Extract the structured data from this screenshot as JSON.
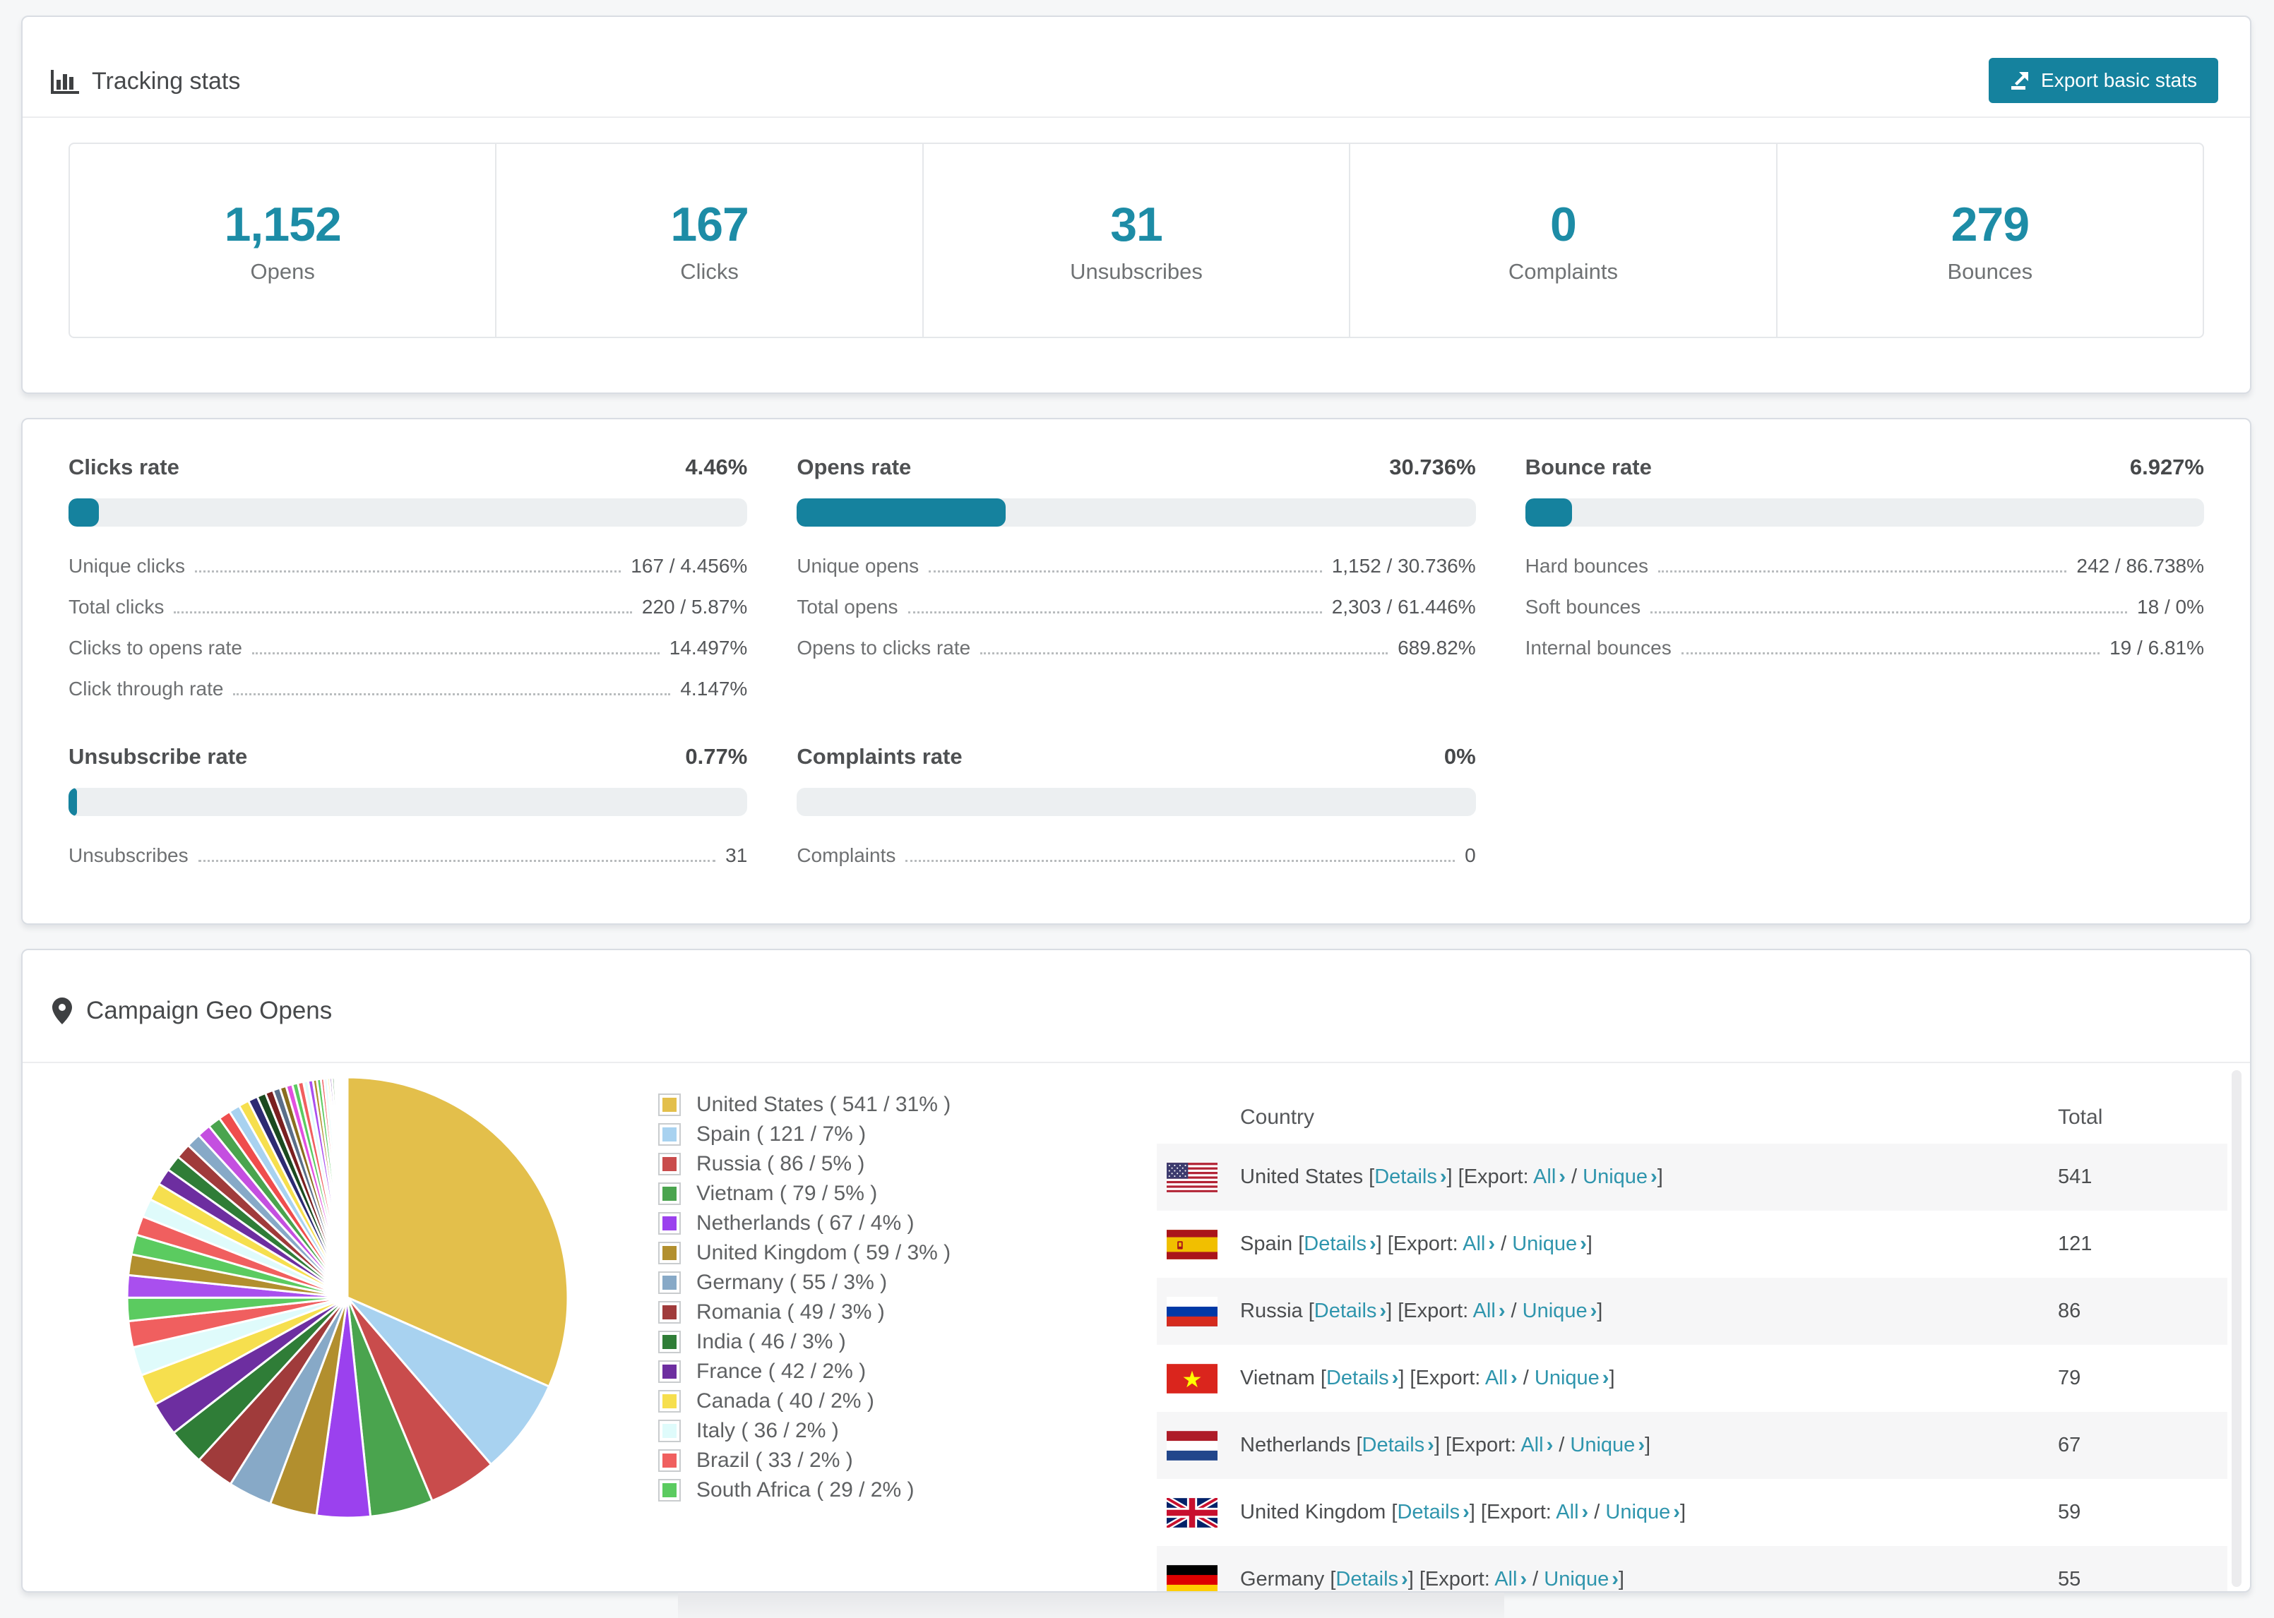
{
  "colors": {
    "accent": "#15829e",
    "number": "#1d8ca6",
    "link": "#2f95ad"
  },
  "header": {
    "icon": "bar-chart-icon",
    "title": "Tracking stats",
    "export_button": "Export basic stats"
  },
  "summary": [
    {
      "value": "1,152",
      "label": "Opens"
    },
    {
      "value": "167",
      "label": "Clicks"
    },
    {
      "value": "31",
      "label": "Unsubscribes"
    },
    {
      "value": "0",
      "label": "Complaints"
    },
    {
      "value": "279",
      "label": "Bounces"
    }
  ],
  "rates": [
    {
      "title": "Clicks rate",
      "percent": "4.46%",
      "fill": 4.46,
      "rows": [
        [
          "Unique clicks",
          "167 / 4.456%"
        ],
        [
          "Total clicks",
          "220 / 5.87%"
        ],
        [
          "Clicks to opens rate",
          "14.497%"
        ],
        [
          "Click through rate",
          "4.147%"
        ]
      ]
    },
    {
      "title": "Opens rate",
      "percent": "30.736%",
      "fill": 30.736,
      "rows": [
        [
          "Unique opens",
          "1,152 / 30.736%"
        ],
        [
          "Total opens",
          "2,303 / 61.446%"
        ],
        [
          "Opens to clicks rate",
          "689.82%"
        ]
      ]
    },
    {
      "title": "Bounce rate",
      "percent": "6.927%",
      "fill": 6.927,
      "rows": [
        [
          "Hard bounces",
          "242 / 86.738%"
        ],
        [
          "Soft bounces",
          "18 / 0%"
        ],
        [
          "Internal bounces",
          "19 / 6.81%"
        ]
      ]
    },
    {
      "title": "Unsubscribe rate",
      "percent": "0.77%",
      "fill": 0.77,
      "rows": [
        [
          "Unsubscribes",
          "31"
        ]
      ]
    },
    {
      "title": "Complaints rate",
      "percent": "0%",
      "fill": 0,
      "rows": [
        [
          "Complaints",
          "0"
        ]
      ]
    }
  ],
  "geo": {
    "icon": "map-marker-icon",
    "title": "Campaign Geo Opens",
    "chart_data": {
      "type": "pie",
      "title": "Campaign Geo Opens",
      "legend_position": "right",
      "start_angle_deg": 0,
      "slices": [
        {
          "label": "United States",
          "value": 541,
          "pct": "31%",
          "color": "#e3bf4b"
        },
        {
          "label": "Spain",
          "value": 121,
          "pct": "7%",
          "color": "#a8d2f0"
        },
        {
          "label": "Russia",
          "value": 86,
          "pct": "5%",
          "color": "#c94c4c"
        },
        {
          "label": "Vietnam",
          "value": 79,
          "pct": "5%",
          "color": "#4aa44e"
        },
        {
          "label": "Netherlands",
          "value": 67,
          "pct": "4%",
          "color": "#9b41ee"
        },
        {
          "label": "United Kingdom",
          "value": 59,
          "pct": "3%",
          "color": "#b28f2e"
        },
        {
          "label": "Germany",
          "value": 55,
          "pct": "3%",
          "color": "#87a9c7"
        },
        {
          "label": "Romania",
          "value": 49,
          "pct": "3%",
          "color": "#a03b3b"
        },
        {
          "label": "India",
          "value": 46,
          "pct": "3%",
          "color": "#2f7d37"
        },
        {
          "label": "France",
          "value": 42,
          "pct": "2%",
          "color": "#6d2ea0"
        },
        {
          "label": "Canada",
          "value": 40,
          "pct": "2%",
          "color": "#f6df4e"
        },
        {
          "label": "Italy",
          "value": 36,
          "pct": "2%",
          "color": "#dffbfb"
        },
        {
          "label": "Brazil",
          "value": 33,
          "pct": "2%",
          "color": "#f05f5f"
        },
        {
          "label": "South Africa",
          "value": 29,
          "pct": "2%",
          "color": "#5bcb60"
        }
      ],
      "others_tail": {
        "values": [
          28,
          26,
          25,
          24,
          23,
          22,
          21,
          20,
          19,
          18,
          17,
          16,
          15,
          14,
          13,
          12,
          11,
          10,
          9,
          8,
          8,
          7,
          7,
          6,
          6,
          5,
          5,
          4,
          4,
          3,
          3,
          3,
          2,
          2,
          2,
          2,
          1,
          1,
          1,
          1,
          1,
          1,
          1,
          1
        ],
        "palette": [
          "#a94fee",
          "#b28f2e",
          "#5bcb60",
          "#f05f5f",
          "#dffbfb",
          "#f6df4e",
          "#6d2ea0",
          "#2f7d37",
          "#a03b3b",
          "#87a9c7",
          "#c44fe0",
          "#4aa44e",
          "#ef4d4d",
          "#a8d2f0",
          "#f6df4e",
          "#2d2a72",
          "#1b4a1f",
          "#7a2020",
          "#5b6f8a",
          "#8a6d1f",
          "#e24fe0",
          "#5bcb60",
          "#f05f5f",
          "#dffbfb"
        ]
      }
    },
    "table": {
      "headers": [
        "Country",
        "Total"
      ],
      "link_labels": {
        "details": "Details",
        "export": "Export:",
        "all": "All",
        "unique": "Unique",
        "chevron": "›"
      },
      "rows": [
        {
          "flag": "us",
          "country": "United States",
          "total": "541"
        },
        {
          "flag": "es",
          "country": "Spain",
          "total": "121"
        },
        {
          "flag": "ru",
          "country": "Russia",
          "total": "86"
        },
        {
          "flag": "vn",
          "country": "Vietnam",
          "total": "79"
        },
        {
          "flag": "nl",
          "country": "Netherlands",
          "total": "67"
        },
        {
          "flag": "gb",
          "country": "United Kingdom",
          "total": "59"
        },
        {
          "flag": "de",
          "country": "Germany",
          "total": "55"
        }
      ]
    }
  }
}
